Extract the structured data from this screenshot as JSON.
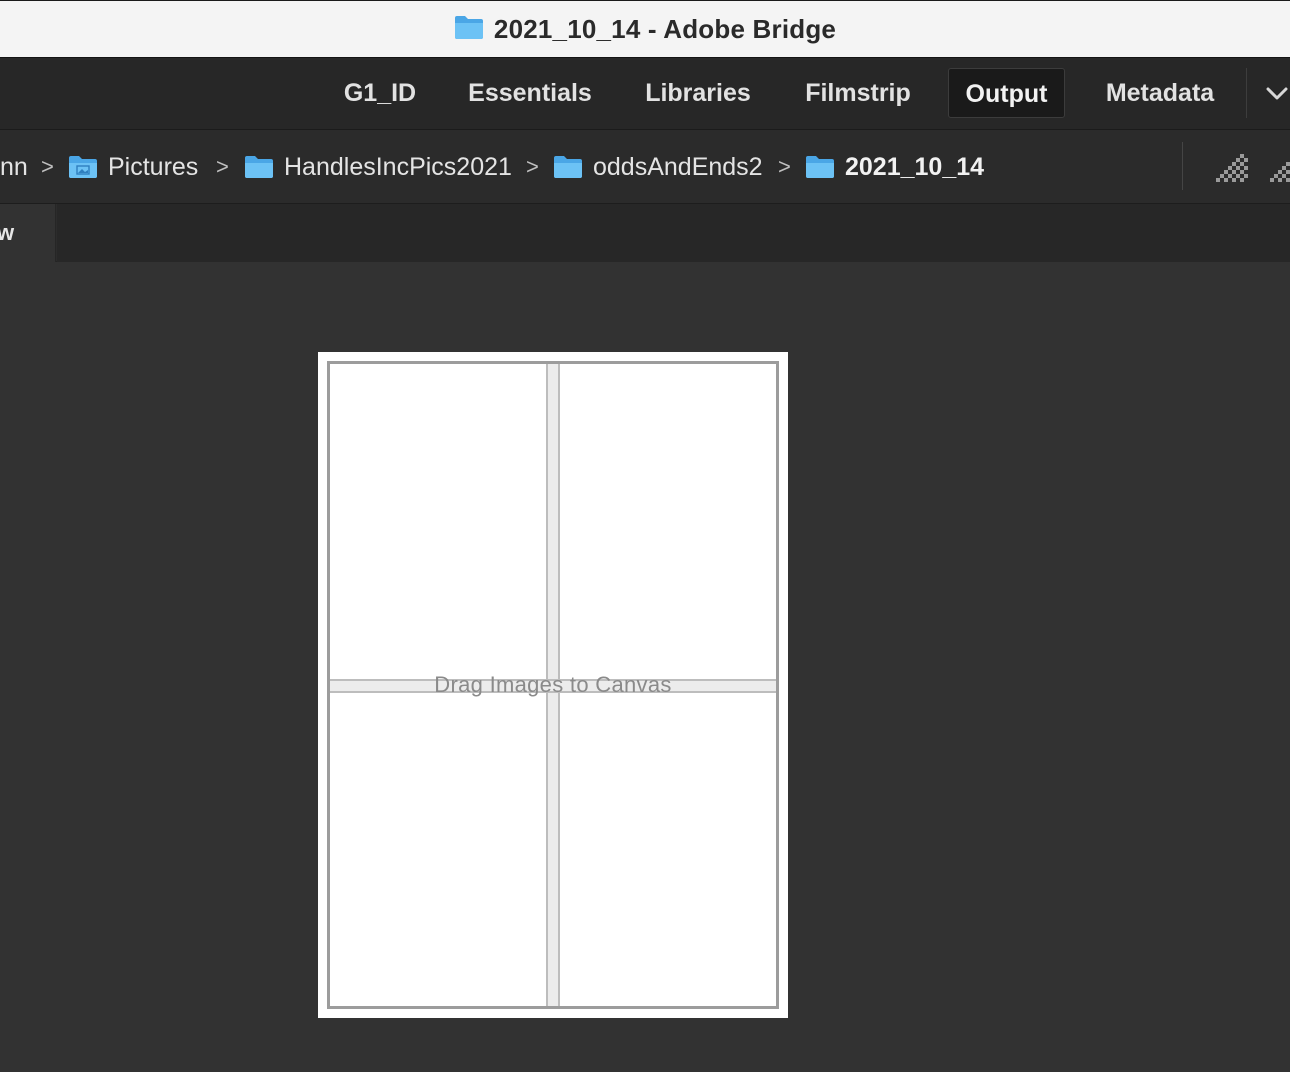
{
  "window": {
    "title": "2021_10_14 - Adobe Bridge",
    "icon": "folder-icon"
  },
  "workspaces": {
    "tabs": [
      {
        "label": "G1_ID",
        "active": false
      },
      {
        "label": "Essentials",
        "active": false
      },
      {
        "label": "Libraries",
        "active": false
      },
      {
        "label": "Filmstrip",
        "active": false
      },
      {
        "label": "Output",
        "active": true
      },
      {
        "label": "Metadata",
        "active": false
      }
    ],
    "more_icon": "chevron-down-icon"
  },
  "path": {
    "crumbs": [
      {
        "label": "nn",
        "icon": ""
      },
      {
        "label": "Pictures",
        "icon": "pictures-folder-icon"
      },
      {
        "label": "HandlesIncPics2021",
        "icon": "folder-icon"
      },
      {
        "label": "oddsAndEnds2",
        "icon": "folder-icon"
      },
      {
        "label": "2021_10_14",
        "icon": "folder-icon"
      }
    ],
    "separator": ">",
    "thumbnail_size_icons": [
      "thumbnail-size-small-icon",
      "thumbnail-size-large-icon"
    ]
  },
  "panel": {
    "tab_label": "w"
  },
  "canvas": {
    "hint": "Drag Images to Canvas",
    "grid": {
      "rows": 2,
      "columns": 2
    }
  },
  "colors": {
    "background": "#323232",
    "folder_blue": "#5ab4ef",
    "active_tab": "#1a1a1a"
  }
}
